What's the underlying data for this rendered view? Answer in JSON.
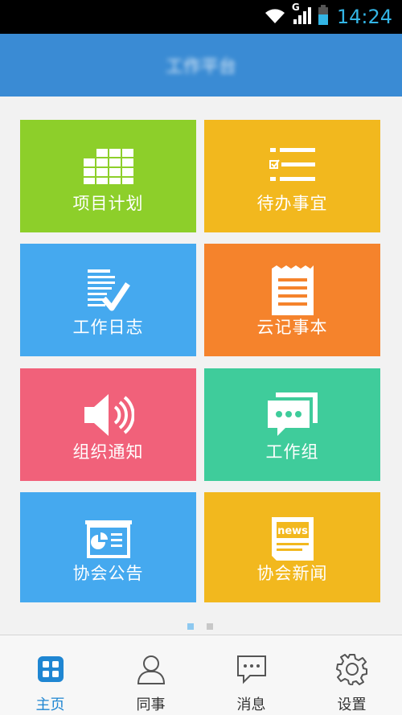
{
  "status_bar": {
    "time": "14:24",
    "network_label": "G",
    "icons": [
      "wifi-icon",
      "signal-icon",
      "battery-icon"
    ]
  },
  "header": {
    "title": "工作平台"
  },
  "tiles": [
    {
      "label": "项目计划",
      "icon": "grid-table-icon",
      "color": "#8dcf2a"
    },
    {
      "label": "待办事宜",
      "icon": "checklist-icon",
      "color": "#f2b81e"
    },
    {
      "label": "工作日志",
      "icon": "log-check-icon",
      "color": "#45a9ef"
    },
    {
      "label": "云记事本",
      "icon": "notepad-icon",
      "color": "#f5832c"
    },
    {
      "label": "组织通知",
      "icon": "speaker-icon",
      "color": "#f1617a"
    },
    {
      "label": "工作组",
      "icon": "chat-bubbles-icon",
      "color": "#3fcc9b"
    },
    {
      "label": "协会公告",
      "icon": "announcement-board-icon",
      "color": "#45a9ef"
    },
    {
      "label": "协会新闻",
      "icon": "news-icon",
      "color": "#f2b81e"
    }
  ],
  "news_icon_text": "news",
  "pager": {
    "pages": 2,
    "current": 1
  },
  "bottom_nav": [
    {
      "label": "主页",
      "icon": "home-grid-icon",
      "active": true
    },
    {
      "label": "同事",
      "icon": "person-icon",
      "active": false
    },
    {
      "label": "消息",
      "icon": "message-icon",
      "active": false
    },
    {
      "label": "设置",
      "icon": "gear-icon",
      "active": false
    }
  ],
  "colors": {
    "header": "#3a8bd4",
    "status_accent": "#33b5e5",
    "nav_active": "#1f86d2"
  }
}
